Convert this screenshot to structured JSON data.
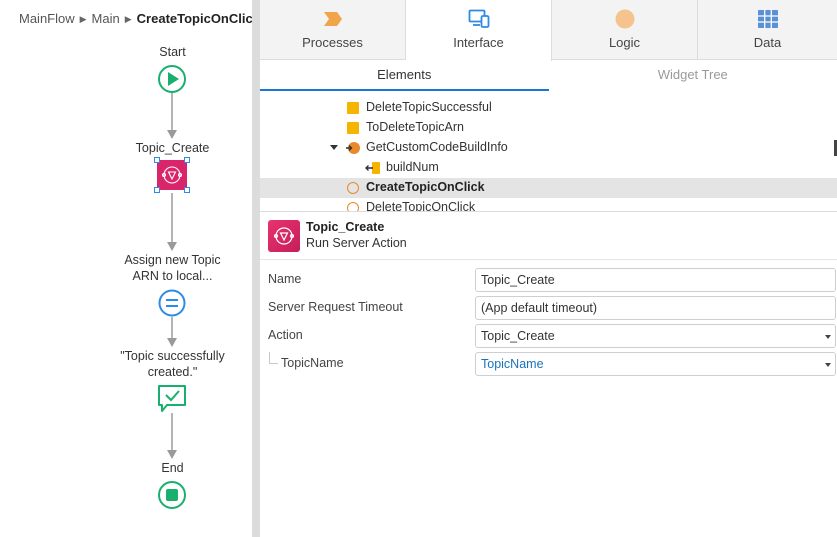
{
  "breadcrumb": {
    "items": [
      "MainFlow",
      "Main"
    ],
    "current": "CreateTopicOnClick"
  },
  "flow": {
    "start_label": "Start",
    "server_action_label": "Topic_Create",
    "assign_label_line1": "Assign new Topic",
    "assign_label_line2": "ARN to local...",
    "message_label_line1": "\"Topic successfully",
    "message_label_line2": "created.\"",
    "end_label": "End",
    "colors": {
      "start_end": "#19b06d",
      "server_action": "#d9266b",
      "assign": "#2d8ae6",
      "message": "#19b06d",
      "connector": "#9a9a9a"
    }
  },
  "tabs": [
    {
      "label": "Processes",
      "icon": "processes-icon"
    },
    {
      "label": "Interface",
      "icon": "interface-icon",
      "active": true
    },
    {
      "label": "Logic",
      "icon": "logic-icon"
    },
    {
      "label": "Data",
      "icon": "data-icon"
    }
  ],
  "subtabs": {
    "elements": "Elements",
    "widget_tree": "Widget Tree"
  },
  "tree": {
    "items": [
      {
        "label": "DeleteTopicSuccessful",
        "icon": "local-variable-icon"
      },
      {
        "label": "ToDeleteTopicArn",
        "icon": "local-variable-icon"
      },
      {
        "label": "GetCustomCodeBuildInfo",
        "icon": "aggregate-icon",
        "expanded": true
      },
      {
        "label": "buildNum",
        "icon": "output-parameter-icon"
      },
      {
        "label": "CreateTopicOnClick",
        "icon": "client-action-icon",
        "selected": true
      },
      {
        "label": "DeleteTopicOnClick",
        "icon": "client-action-icon"
      }
    ]
  },
  "properties": {
    "title": "Topic_Create",
    "subtitle": "Run Server Action",
    "fields": {
      "name": {
        "label": "Name",
        "value": "Topic_Create"
      },
      "timeout": {
        "label": "Server Request Timeout",
        "value": "(App default timeout)"
      },
      "action": {
        "label": "Action",
        "value": "Topic_Create"
      },
      "topic_name": {
        "label": "TopicName",
        "value": "TopicName"
      }
    }
  }
}
